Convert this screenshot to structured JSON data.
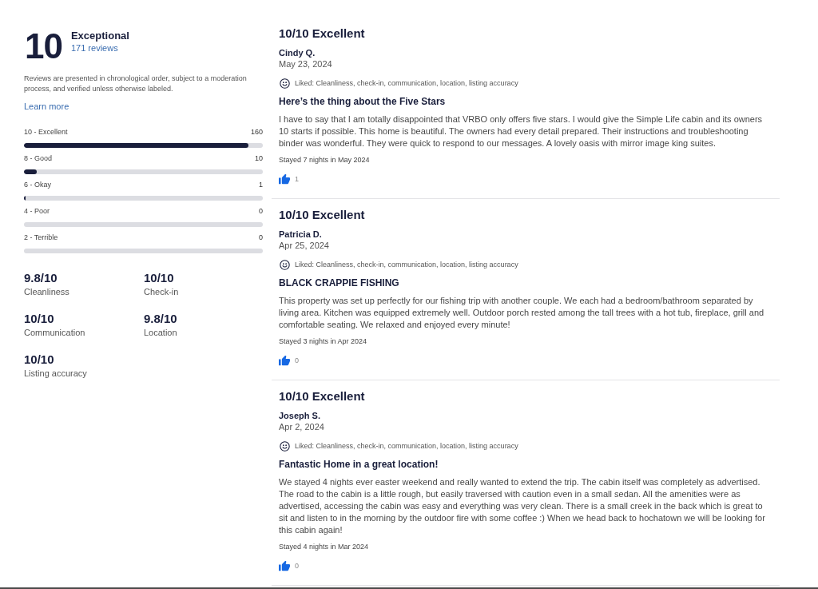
{
  "summary": {
    "score": "10",
    "label": "Exceptional",
    "review_count": "171 reviews"
  },
  "disclaimer": "Reviews are presented in chronological order, subject to a moderation process, and verified unless otherwise labeled.",
  "learn_more": "Learn more",
  "rating_distribution": [
    {
      "label": "10 - Excellent",
      "count": "160",
      "level": 0.94
    },
    {
      "label": "8 - Good",
      "count": "10",
      "level": 0.055
    },
    {
      "label": "6 - Okay",
      "count": "1",
      "level": 0.008
    },
    {
      "label": "4 - Poor",
      "count": "0",
      "level": 0
    },
    {
      "label": "2 - Terrible",
      "count": "0",
      "level": 0
    }
  ],
  "category_scores": [
    {
      "score": "9.8/10",
      "label": "Cleanliness"
    },
    {
      "score": "10/10",
      "label": "Check-in"
    },
    {
      "score": "10/10",
      "label": "Communication"
    },
    {
      "score": "9.8/10",
      "label": "Location"
    },
    {
      "score": "10/10",
      "label": "Listing accuracy"
    }
  ],
  "reviews": [
    {
      "rating": "10/10 Excellent",
      "author": "Cindy Q.",
      "date": "May 23, 2024",
      "liked": "Liked: Cleanliness, check-in, communication, location, listing accuracy",
      "title": "Here’s the thing about the Five Stars",
      "body": "I have to say that I am totally disappointed that VRBO only offers five stars. I would give the Simple Life cabin and its owners 10 starts if possible. This home is beautiful. The owners had every detail prepared. Their instructions and troubleshooting binder was wonderful. They were quick to respond to our messages. A lovely oasis with mirror image king suites.",
      "stay": "Stayed 7 nights in May 2024",
      "helpful_count": "1"
    },
    {
      "rating": "10/10 Excellent",
      "author": "Patricia D.",
      "date": "Apr 25, 2024",
      "liked": "Liked: Cleanliness, check-in, communication, location, listing accuracy",
      "title": "BLACK CRAPPIE FISHING",
      "body": "This property was set up perfectly for our fishing trip with another couple. We each had a bedroom/bathroom separated by living area. Kitchen was equipped extremely well. Outdoor porch rested among the tall trees with a hot tub, fireplace, grill and comfortable seating. We relaxed and enjoyed every minute!",
      "stay": "Stayed 3 nights in Apr 2024",
      "helpful_count": "0"
    },
    {
      "rating": "10/10 Excellent",
      "author": "Joseph S.",
      "date": "Apr 2, 2024",
      "liked": "Liked: Cleanliness, check-in, communication, location, listing accuracy",
      "title": "Fantastic Home in a great location!",
      "body": "We stayed 4 nights ever easter weekend and really wanted to extend the trip. The cabin itself was completely as advertised. The road to the cabin is a little rough, but easily traversed with caution even in a small sedan. All the amenities were as advertised, accessing the cabin was easy and everything was very clean. There is a small creek in the back which is great to sit and listen to in the morning by the outdoor fire with some coffee :) When we head back to hochatown we will be looking for this cabin again!",
      "stay": "Stayed 4 nights in Mar 2024",
      "helpful_count": "0"
    }
  ]
}
